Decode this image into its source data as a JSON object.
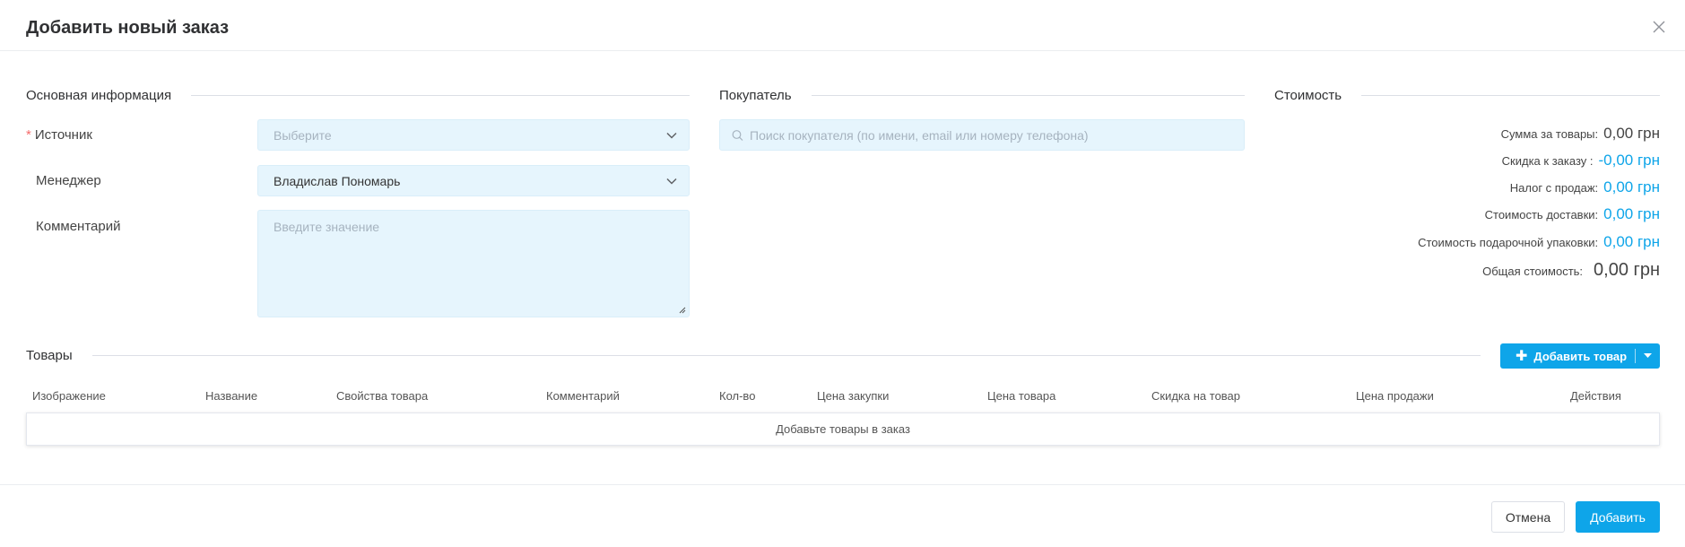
{
  "dialog": {
    "title": "Добавить новый заказ"
  },
  "basic_info": {
    "heading": "Основная информация",
    "source": {
      "label": "Источник",
      "required_mark": "*",
      "placeholder": "Выберите"
    },
    "manager": {
      "label": "Менеджер",
      "value": "Владислав Пономарь"
    },
    "comment": {
      "label": "Комментарий",
      "placeholder": "Введите значение"
    }
  },
  "buyer": {
    "heading": "Покупатель",
    "search_placeholder": "Поиск покупателя (по имени, email или номеру телефона)"
  },
  "cost": {
    "heading": "Стоимость",
    "rows": [
      {
        "label": "Сумма за товары:",
        "value": "0,00 грн"
      },
      {
        "label": "Скидка к заказу :",
        "value": "-0,00 грн"
      },
      {
        "label": "Налог с продаж:",
        "value": "0,00 грн"
      },
      {
        "label": "Стоимость доставки:",
        "value": "0,00 грн"
      },
      {
        "label": "Стоимость подарочной упаковки:",
        "value": "0,00 грн"
      },
      {
        "label": "Общая стоимость:",
        "value": "0,00 грн"
      }
    ]
  },
  "products": {
    "heading": "Товары",
    "add_button": "Добавить товар",
    "columns": [
      "Изображение",
      "Название",
      "Свойства товара",
      "Комментарий",
      "Кол-во",
      "Цена закупки",
      "Цена товара",
      "Скидка на товар",
      "Цена продажи",
      "Действия"
    ],
    "empty_text": "Добавьте товары в заказ"
  },
  "footer": {
    "cancel": "Отмена",
    "submit": "Добавить"
  },
  "colors": {
    "accent": "#0ea5e9",
    "field_bg": "#e6f5fd",
    "required": "#f56c6c"
  }
}
